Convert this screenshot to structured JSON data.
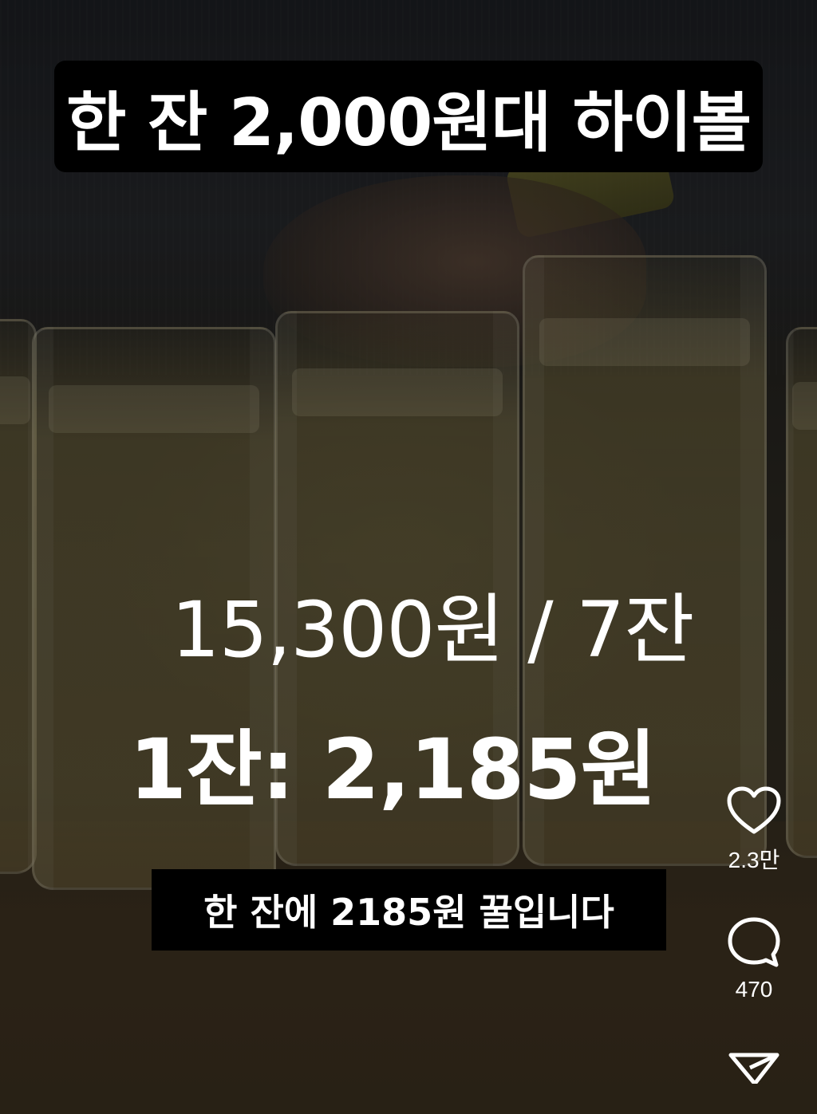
{
  "video": {
    "title": "한 잔 2,000원대 하이볼",
    "price_total": "15,300원 / 7잔",
    "price_per_glass": "1잔: 2,185원",
    "caption": "한 잔에 2185원 꿀입니다"
  },
  "actions": {
    "like": {
      "icon": "heart-icon",
      "count": "2.3만"
    },
    "comment": {
      "icon": "comment-bubble-icon",
      "count": "470"
    },
    "share": {
      "icon": "send-icon"
    }
  }
}
